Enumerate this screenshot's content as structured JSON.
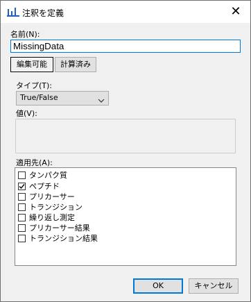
{
  "window": {
    "title": "注釈を定義",
    "close_symbol": "✕"
  },
  "name": {
    "label": "名前(N):",
    "value": "MissingData"
  },
  "tabs": [
    {
      "label": "編集可能",
      "active": true
    },
    {
      "label": "計算済み",
      "active": false
    }
  ],
  "type": {
    "label": "タイプ(T):",
    "selected": "True/False"
  },
  "value": {
    "label": "値(V):"
  },
  "applies_to": {
    "label": "適用先(A):",
    "items": [
      {
        "label": "タンパク質",
        "checked": false
      },
      {
        "label": "ペプチド",
        "checked": true
      },
      {
        "label": "プリカーサー",
        "checked": false
      },
      {
        "label": "トランジション",
        "checked": false
      },
      {
        "label": "繰り返し測定",
        "checked": false
      },
      {
        "label": "プリカーサー結果",
        "checked": false
      },
      {
        "label": "トランジション結果",
        "checked": false
      }
    ]
  },
  "buttons": {
    "ok": "OK",
    "cancel": "キャンセル"
  },
  "colors": {
    "accent": "#0078d7",
    "icon_blue": "#1f5fbf"
  }
}
